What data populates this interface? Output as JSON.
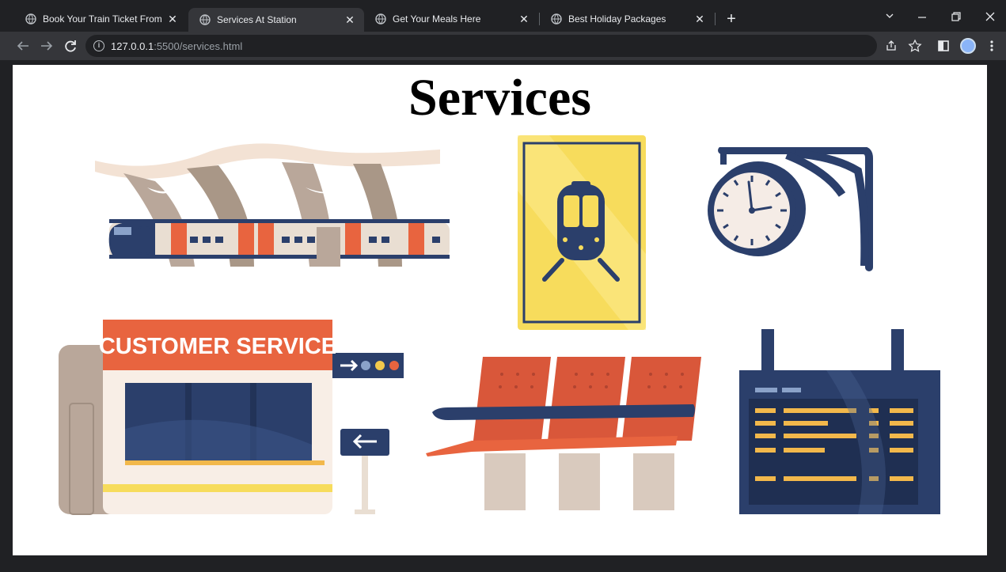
{
  "browser": {
    "tabs": [
      {
        "title": "Book Your Train Ticket From Your",
        "active": false
      },
      {
        "title": "Services At Station",
        "active": true
      },
      {
        "title": "Get Your Meals Here",
        "active": false
      },
      {
        "title": "Best Holiday Packages",
        "active": false
      }
    ],
    "close_glyph": "✕",
    "new_tab_glyph": "+",
    "url_host": "127.0.0.1",
    "url_path": ":5500/services.html"
  },
  "page": {
    "heading": "Services",
    "customer_service_sign": "CUSTOMER SERVICE"
  },
  "colors": {
    "accent_orange": "#e8643f",
    "navy": "#2b3f6b",
    "yellow": "#f7dc5c"
  }
}
